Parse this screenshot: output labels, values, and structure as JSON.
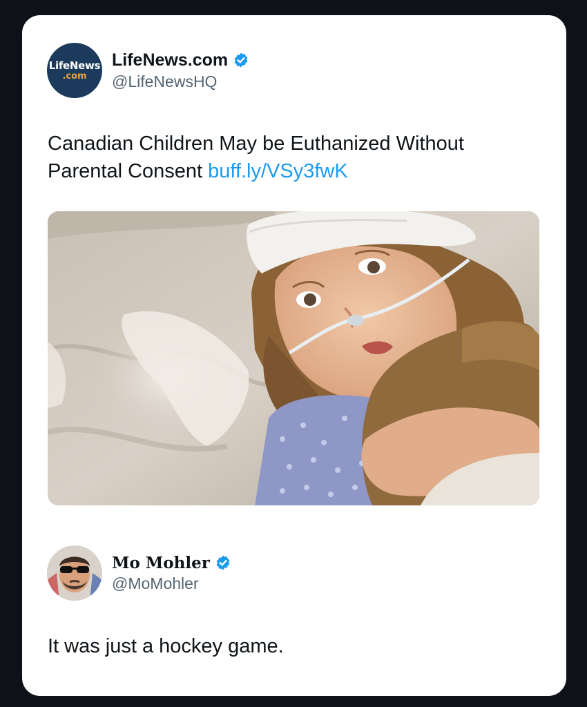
{
  "tweet1": {
    "avatar": {
      "brand_top": "LifeNews",
      "brand_bottom": ".com"
    },
    "display_name": "LifeNews.com",
    "verified": true,
    "handle": "@LifeNewsHQ",
    "text": "Canadian Children May be Euthanized Without Parental Consent",
    "link": "buff.ly/VSy3fwK",
    "media": {
      "icon": "photo-child-hospital-bed"
    }
  },
  "tweet2": {
    "display_name": "Mo Mohler",
    "verified": true,
    "handle": "@MoMohler",
    "text": "It was just a hockey game."
  },
  "colors": {
    "background": "#0e1117",
    "card": "#ffffff",
    "link": "#1d9bf0",
    "verified_badge": "#1d9bf0",
    "handle": "#536471",
    "text": "#0f1419"
  }
}
